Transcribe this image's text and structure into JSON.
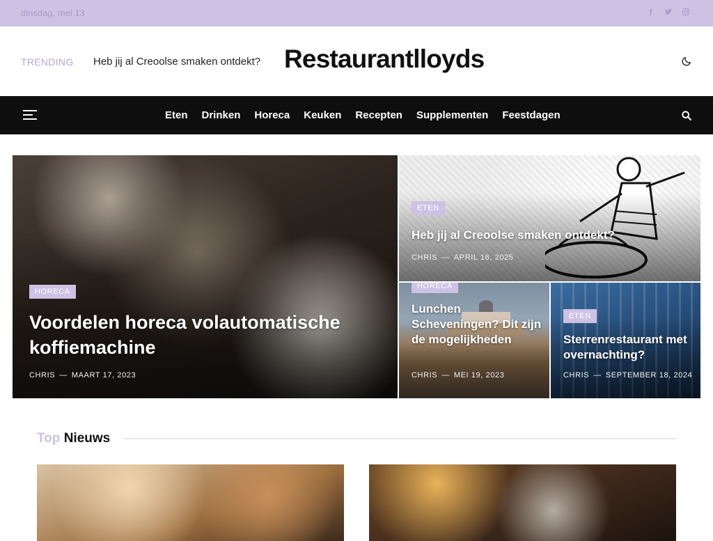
{
  "topbar": {
    "date": "dinsdag, mei 13",
    "social": [
      "facebook-icon",
      "twitter-icon",
      "instagram-icon"
    ]
  },
  "header": {
    "trending_label": "TRENDING",
    "trending_text": "Heb jij al Creoolse smaken ontdekt?",
    "logo": "Restaurantlloyds"
  },
  "nav": {
    "items": [
      "Eten",
      "Drinken",
      "Horeca",
      "Keuken",
      "Recepten",
      "Supplementen",
      "Feestdagen"
    ]
  },
  "featured": {
    "main": {
      "category": "HORECA",
      "title": "Voordelen horeca volautomatische koffiemachine",
      "author": "CHRIS",
      "date": "MAART 17, 2023"
    },
    "a": {
      "category": "ETEN",
      "title": "Heb jij al Creoolse smaken ontdekt?",
      "author": "CHRIS",
      "date": "APRIL 16, 2025"
    },
    "b": {
      "category": "HORECA",
      "title": "Lunchen Scheveningen? Dit zijn de mogelijkheden",
      "author": "CHRIS",
      "date": "MEI 19, 2023"
    },
    "c": {
      "category": "ETEN",
      "title": "Sterrenrestaurant met overnachting?",
      "author": "CHRIS",
      "date": "SEPTEMBER 18, 2024"
    }
  },
  "section": {
    "pre": "Top",
    "title": "Nieuws"
  },
  "meta_sep": "—",
  "colors": {
    "accent": "#cdc2e3",
    "nav_bg": "#0e0e0e"
  }
}
